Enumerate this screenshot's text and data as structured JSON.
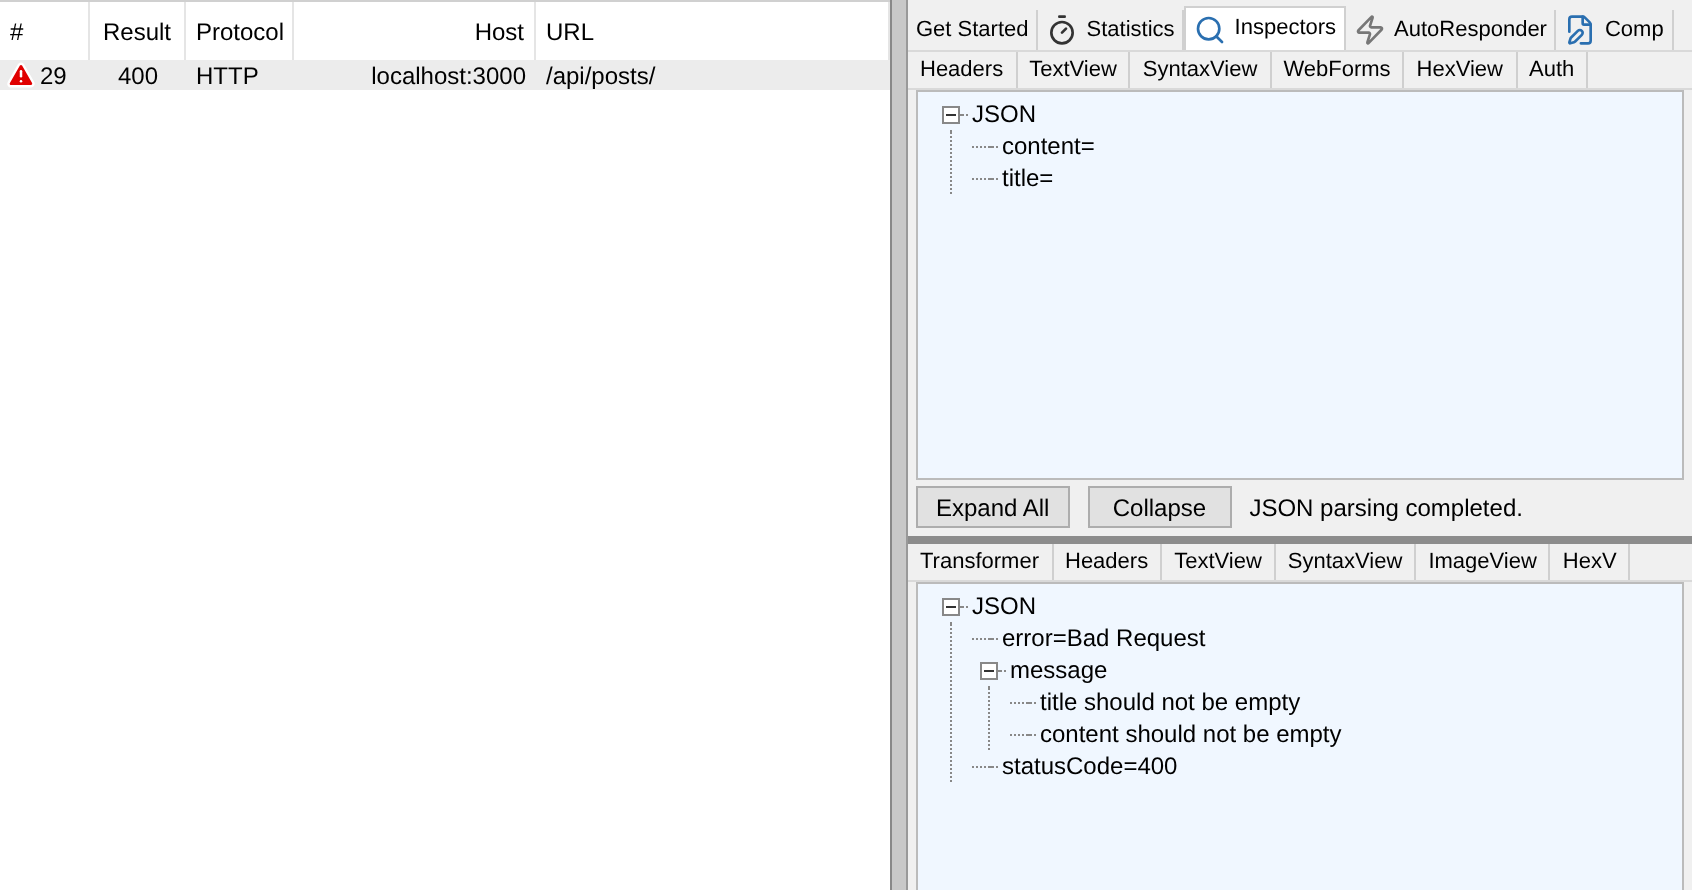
{
  "sessions": {
    "columns": [
      "#",
      "Result",
      "Protocol",
      "Host",
      "URL"
    ],
    "rows": [
      {
        "number": "29",
        "result": "400",
        "protocol": "HTTP",
        "host": "localhost:3000",
        "url": "/api/posts/",
        "selected": true
      }
    ]
  },
  "main_tabs": [
    {
      "label": "Get Started",
      "kind": "plain",
      "selected": false
    },
    {
      "label": "Statistics",
      "kind": "stopwatch",
      "selected": false
    },
    {
      "label": "Inspectors",
      "kind": "magnifier",
      "selected": true
    },
    {
      "label": "AutoResponder",
      "kind": "lightning",
      "selected": false
    },
    {
      "label": "Comp",
      "kind": "pencil",
      "selected": false
    }
  ],
  "request": {
    "tabs": [
      {
        "label": "Headers",
        "selected": false
      },
      {
        "label": "TextView",
        "selected": false
      },
      {
        "label": "SyntaxView",
        "selected": false
      },
      {
        "label": "WebForms",
        "selected": false
      },
      {
        "label": "HexView",
        "selected": false
      },
      {
        "label": "Auth",
        "selected": false
      }
    ],
    "tree": [
      {
        "label": "JSON",
        "expanded": true,
        "children": [
          {
            "label": "content="
          },
          {
            "label": "title="
          }
        ]
      }
    ],
    "buttons": [
      "Expand All",
      "Collapse"
    ],
    "status": "JSON parsing completed."
  },
  "response": {
    "tabs": [
      {
        "label": "Transformer",
        "selected": false
      },
      {
        "label": "Headers",
        "selected": false
      },
      {
        "label": "TextView",
        "selected": false
      },
      {
        "label": "SyntaxView",
        "selected": false
      },
      {
        "label": "ImageView",
        "selected": false
      },
      {
        "label": "HexV",
        "selected": false
      }
    ],
    "tree": [
      {
        "label": "JSON",
        "expanded": true,
        "children": [
          {
            "label": "error=Bad Request"
          },
          {
            "label": "message",
            "expanded": true,
            "children": [
              {
                "label": "title should not be empty"
              },
              {
                "label": "content should not be empty"
              }
            ]
          },
          {
            "label": "statusCode=400"
          }
        ]
      }
    ]
  }
}
